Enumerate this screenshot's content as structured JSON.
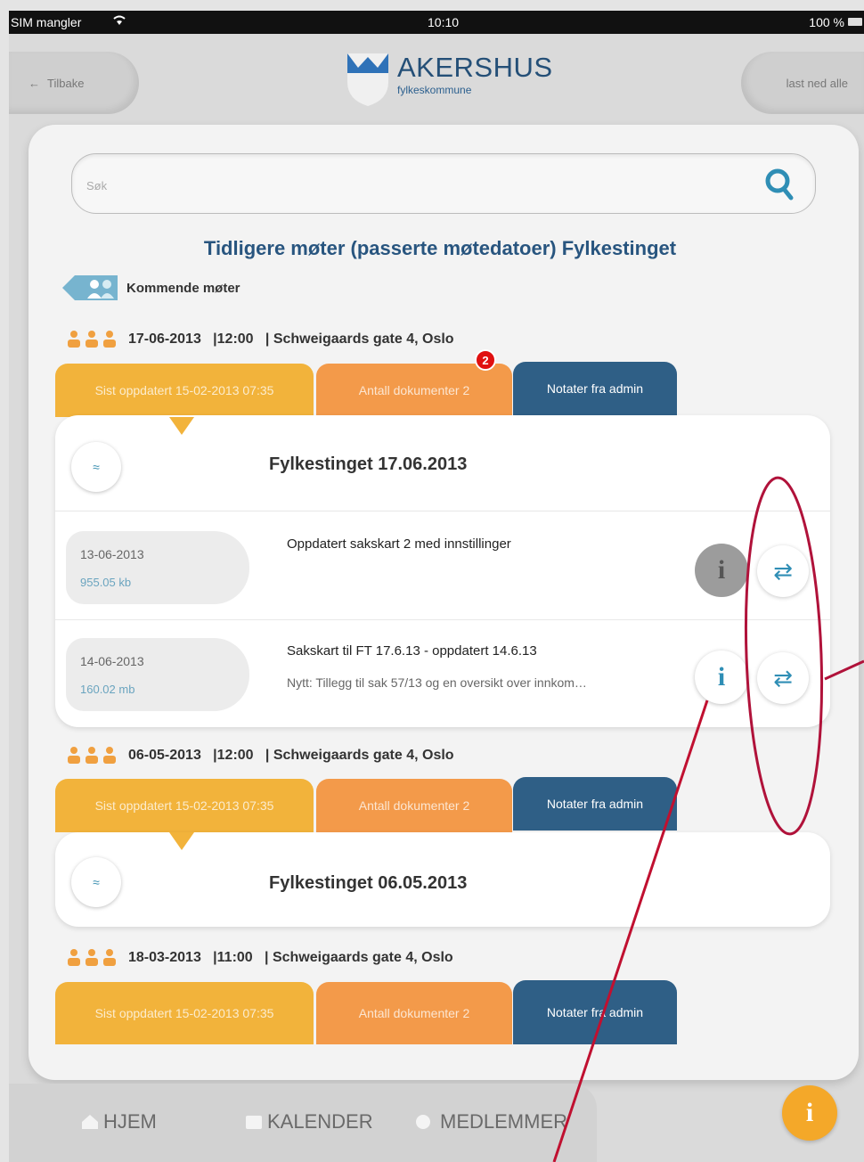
{
  "status_bar": {
    "carrier": "SIM mangler",
    "time": "10:10",
    "battery": "100 %"
  },
  "header": {
    "back_label": "Tilbake",
    "download_label": "last ned alle",
    "logo_name": "AKERSHUS",
    "logo_sub": "fylkeskommune"
  },
  "search": {
    "placeholder": "Søk"
  },
  "page_title": "Tidligere møter (passerte møtedatoer) Fylkestinget",
  "upcoming_label": "Kommende møter",
  "meetings": [
    {
      "info": "17-06-2013   |12:00   | Schweigaards gate 4, Oslo",
      "tabs": {
        "updated": "Sist oppdatert 15-02-2013 07:35",
        "doc_count": "Antall dokumenter 2",
        "notes": "Notater fra admin"
      },
      "badge": "2",
      "title": "Fylkestinget 17.06.2013",
      "documents": [
        {
          "date": "13-06-2013",
          "size": "955.05 kb",
          "title": "Oppdatert sakskart 2 med innstillinger",
          "note": ""
        },
        {
          "date": "14-06-2013",
          "size": "160.02 mb",
          "title": "Sakskart til FT 17.6.13 - oppdatert 14.6.13",
          "note": "Nytt: Tillegg til sak 57/13 og en oversikt over innkom…"
        }
      ]
    },
    {
      "info": "06-05-2013   |12:00   | Schweigaards gate 4, Oslo",
      "tabs": {
        "updated": "Sist oppdatert 15-02-2013 07:35",
        "doc_count": "Antall dokumenter 2",
        "notes": "Notater fra admin"
      },
      "title": "Fylkestinget 06.05.2013"
    },
    {
      "info": "18-03-2013   |11:00   | Schweigaards gate 4, Oslo",
      "tabs": {
        "updated": "Sist oppdatert 15-02-2013 07:35",
        "doc_count": "Antall dokumenter 2",
        "notes": "Notater fra admin"
      }
    }
  ],
  "bottom_nav": {
    "home": "HJEM",
    "calendar": "KALENDER",
    "members": "MEDLEMMER"
  },
  "icons": {
    "info": "i",
    "sync": "⇄",
    "collapse": "≈",
    "back_arrow": "←",
    "wifi": "wifi-icon"
  },
  "colors": {
    "accent_yellow": "#f2b33b",
    "accent_orange": "#f39a4a",
    "accent_blue": "#2f5f86",
    "title_blue": "#28557f",
    "annotation_red": "#b0123a"
  }
}
